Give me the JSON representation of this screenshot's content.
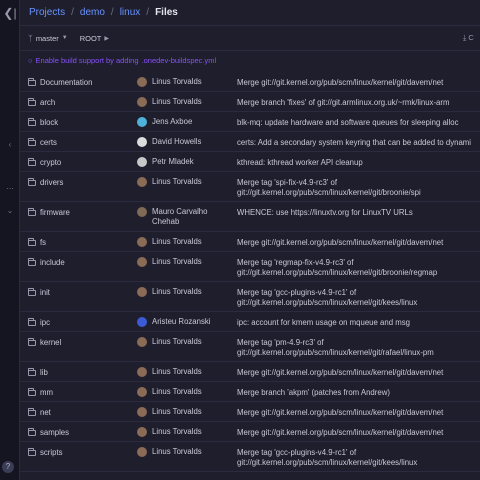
{
  "breadcrumb": {
    "items": [
      "Projects",
      "demo",
      "linux",
      "Files"
    ]
  },
  "toolbar": {
    "branch": "master",
    "path": "ROOT",
    "download_label": "C"
  },
  "build_support": {
    "text": "Enable build support by adding",
    "file": ".onedev-buildspec.yml"
  },
  "colors": {
    "link": "#6993ff",
    "purple": "#8950fc",
    "bg": "#1e1e2d",
    "sidebar": "#151521"
  },
  "icons": [
    "menu-toggle-icon",
    "branch-icon",
    "folder-icon",
    "download-icon",
    "bulb-icon",
    "help-icon"
  ],
  "files": [
    {
      "name": "Documentation",
      "author": "Linus Torvalds",
      "avatar": "#8a6b55",
      "message": "Merge git://git.kernel.org/pub/scm/linux/kernel/git/davem/net",
      "height": 20
    },
    {
      "name": "arch",
      "author": "Linus Torvalds",
      "avatar": "#8a6b55",
      "message": "Merge branch 'fixes' of git://git.armlinux.org.uk/~rmk/linux-arm",
      "height": 20
    },
    {
      "name": "block",
      "author": "Jens Axboe",
      "avatar": "#4fb0d9",
      "message": "blk-mq: update hardware and software queues for sleeping alloc",
      "height": 20
    },
    {
      "name": "certs",
      "author": "David Howells",
      "avatar": "#dcdcdc",
      "message": "certs: Add a secondary system keyring that can be added to dynami",
      "height": 20
    },
    {
      "name": "crypto",
      "author": "Petr Mladek",
      "avatar": "#c7c7c7",
      "message": "kthread: kthread worker API cleanup",
      "height": 20
    },
    {
      "name": "drivers",
      "author": "Linus Torvalds",
      "avatar": "#8a6b55",
      "message": "Merge tag 'spi-fix-v4.9-rc3' of\ngit://git.kernel.org/pub/scm/linux/kernel/git/broonie/spi",
      "height": 30
    },
    {
      "name": "firmware",
      "author": "Mauro Carvalho Chehab",
      "avatar": "#7e6a55",
      "message": "WHENCE: use https://linuxtv.org for LinuxTV URLs",
      "height": 30
    },
    {
      "name": "fs",
      "author": "Linus Torvalds",
      "avatar": "#8a6b55",
      "message": "Merge git://git.kernel.org/pub/scm/linux/kernel/git/davem/net",
      "height": 20
    },
    {
      "name": "include",
      "author": "Linus Torvalds",
      "avatar": "#8a6b55",
      "message": "Merge tag 'regmap-fix-v4.9-rc3' of\ngit://git.kernel.org/pub/scm/linux/kernel/git/broonie/regmap",
      "height": 30
    },
    {
      "name": "init",
      "author": "Linus Torvalds",
      "avatar": "#8a6b55",
      "message": "Merge tag 'gcc-plugins-v4.9-rc1' of\ngit://git.kernel.org/pub/scm/linux/kernel/git/kees/linux",
      "height": 30
    },
    {
      "name": "ipc",
      "author": "Aristeu Rozanski",
      "avatar": "#3b5bd6",
      "message": "ipc: account for kmem usage on mqueue and msg",
      "height": 20
    },
    {
      "name": "kernel",
      "author": "Linus Torvalds",
      "avatar": "#8a6b55",
      "message": "Merge tag 'pm-4.9-rc3' of\ngit://git.kernel.org/pub/scm/linux/kernel/git/rafael/linux-pm",
      "height": 30
    },
    {
      "name": "lib",
      "author": "Linus Torvalds",
      "avatar": "#8a6b55",
      "message": "Merge git://git.kernel.org/pub/scm/linux/kernel/git/davem/net",
      "height": 20
    },
    {
      "name": "mm",
      "author": "Linus Torvalds",
      "avatar": "#8a6b55",
      "message": "Merge branch 'akpm' (patches from Andrew)",
      "height": 20
    },
    {
      "name": "net",
      "author": "Linus Torvalds",
      "avatar": "#8a6b55",
      "message": "Merge git://git.kernel.org/pub/scm/linux/kernel/git/davem/net",
      "height": 20
    },
    {
      "name": "samples",
      "author": "Linus Torvalds",
      "avatar": "#8a6b55",
      "message": "Merge git://git.kernel.org/pub/scm/linux/kernel/git/davem/net",
      "height": 20
    },
    {
      "name": "scripts",
      "author": "Linus Torvalds",
      "avatar": "#8a6b55",
      "message": "Merge tag 'gcc-plugins-v4.9-rc1' of\ngit://git.kernel.org/pub/scm/linux/kernel/git/kees/linux",
      "height": 30
    }
  ]
}
